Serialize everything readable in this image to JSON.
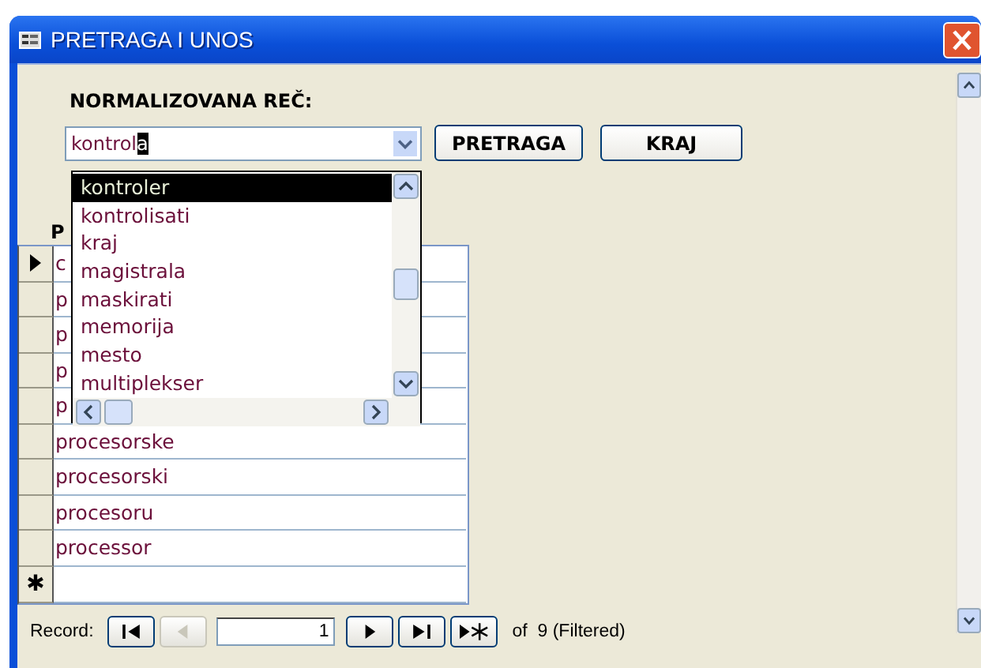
{
  "window": {
    "title": "PRETRAGA I UNOS"
  },
  "search": {
    "label": "NORMALIZOVANA REČ:",
    "typed": "kontrol",
    "autocompleted": "a"
  },
  "dropdown": {
    "items": [
      {
        "text": "kontroler",
        "selected": true
      },
      {
        "text": "kontrolisati",
        "selected": false
      },
      {
        "text": "kraj",
        "selected": false
      },
      {
        "text": "magistrala",
        "selected": false
      },
      {
        "text": "maskirati",
        "selected": false
      },
      {
        "text": "memorija",
        "selected": false
      },
      {
        "text": "mesto",
        "selected": false
      },
      {
        "text": "multiplekser",
        "selected": false
      }
    ]
  },
  "buttons": [
    "PRETRAGA",
    "KRAJ"
  ],
  "subform": {
    "label": "P",
    "rows": [
      {
        "text": "c",
        "current": true
      },
      {
        "text": "p",
        "current": false
      },
      {
        "text": "p",
        "current": false
      },
      {
        "text": "p",
        "current": false
      },
      {
        "text": "p",
        "current": false
      },
      {
        "text": "procesorske",
        "current": false
      },
      {
        "text": "procesorski",
        "current": false
      },
      {
        "text": "procesoru",
        "current": false
      },
      {
        "text": "processor",
        "current": false
      }
    ],
    "new_row_marker": "✱"
  },
  "navigation": {
    "label": "Record:",
    "current": "1",
    "buttons": [
      {
        "kind": "first",
        "disabled": false
      },
      {
        "kind": "previous",
        "disabled": true
      },
      {
        "kind": "next",
        "disabled": false
      },
      {
        "kind": "last",
        "disabled": false
      },
      {
        "kind": "new",
        "disabled": false
      }
    ],
    "total": "of  9 (Filtered)"
  }
}
